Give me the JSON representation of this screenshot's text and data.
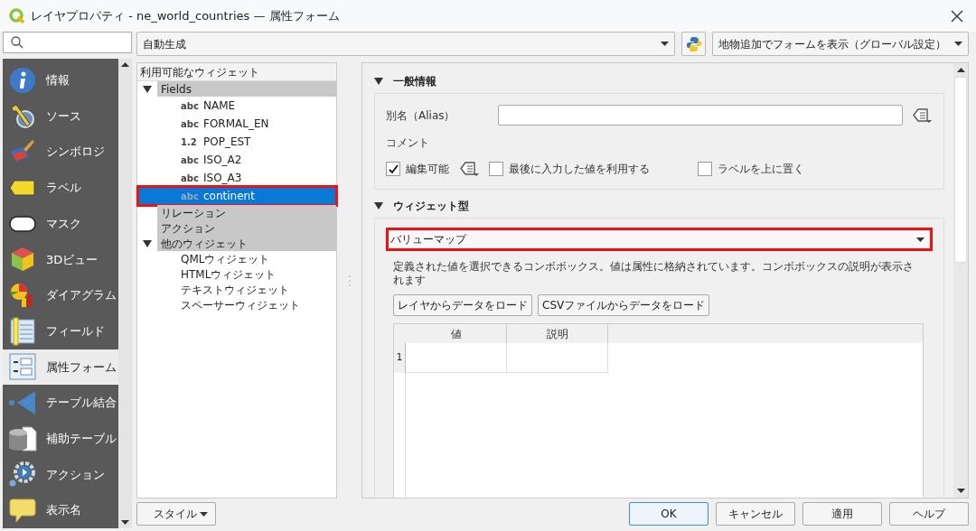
{
  "window": {
    "title": "レイヤプロパティ - ne_world_countries — 属性フォーム"
  },
  "sidebar": {
    "items": [
      {
        "label": "情報",
        "selected": false
      },
      {
        "label": "ソース",
        "selected": false
      },
      {
        "label": "シンボロジ",
        "selected": false
      },
      {
        "label": "ラベル",
        "selected": false
      },
      {
        "label": "マスク",
        "selected": false
      },
      {
        "label": "3Dビュー",
        "selected": false
      },
      {
        "label": "ダイアグラム",
        "selected": false
      },
      {
        "label": "フィールド",
        "selected": false
      },
      {
        "label": "属性フォーム",
        "selected": true
      },
      {
        "label": "テーブル結合",
        "selected": false
      },
      {
        "label": "補助テーブル",
        "selected": false
      },
      {
        "label": "アクション",
        "selected": false
      },
      {
        "label": "表示名",
        "selected": false
      }
    ]
  },
  "layout_dropdown": {
    "value": "自動生成"
  },
  "form_display_dropdown": {
    "value": "地物追加でフォームを表示（グローバル設定）"
  },
  "widget_tree": {
    "title": "利用可能なウィジェット",
    "groups": [
      {
        "label": "Fields",
        "expanded": true,
        "children": [
          {
            "type": "abc",
            "label": "NAME",
            "selected": false,
            "highlighted": false
          },
          {
            "type": "abc",
            "label": "FORMAL_EN",
            "selected": false,
            "highlighted": false
          },
          {
            "type": "1.2",
            "label": "POP_EST",
            "selected": false,
            "highlighted": false
          },
          {
            "type": "abc",
            "label": "ISO_A2",
            "selected": false,
            "highlighted": false
          },
          {
            "type": "abc",
            "label": "ISO_A3",
            "selected": false,
            "highlighted": false
          },
          {
            "type": "abc",
            "label": "continent",
            "selected": true,
            "highlighted": true
          }
        ]
      },
      {
        "label": "リレーション"
      },
      {
        "label": "アクション"
      },
      {
        "label": "他のウィジェット",
        "expanded": true,
        "children": [
          {
            "label": "QMLウィジェット",
            "selected": false,
            "highlighted": false
          },
          {
            "label": "HTMLウィジェット",
            "selected": false,
            "highlighted": false
          },
          {
            "label": "テキストウィジェット",
            "selected": false,
            "highlighted": false
          },
          {
            "label": "スペーサーウィジェット",
            "selected": false,
            "highlighted": false
          }
        ]
      }
    ]
  },
  "general": {
    "title": "一般情報",
    "expanded": true,
    "alias_label": "別名（Alias）",
    "comment_label": "コメント",
    "checkboxes": [
      {
        "label": "編集可能",
        "checked": true
      },
      {
        "label": "最後に入力した値を利用する",
        "checked": false
      },
      {
        "label": "ラベルを上に置く",
        "checked": false
      }
    ]
  },
  "widget_type": {
    "title": "ウィジェット型",
    "expanded": true,
    "dropdown": {
      "value": "バリューマップ",
      "highlighted": true
    },
    "description": "定義された値を選択できるコンボボックス。値は属性に格納されています。コンボボックスの説明が表示されます",
    "buttons": [
      "レイヤからデータをロード",
      "CSVファイルからデータをロード"
    ],
    "table": {
      "columns": [
        "値",
        "説明"
      ],
      "rows": [
        {
          "header": "1"
        }
      ]
    }
  },
  "footer": {
    "style_button": "スタイル",
    "buttons": [
      {
        "label": "OK",
        "default": true
      },
      {
        "label": "キャンセル",
        "default": false
      },
      {
        "label": "適用",
        "default": false
      },
      {
        "label": "ヘルプ",
        "default": false
      }
    ]
  }
}
